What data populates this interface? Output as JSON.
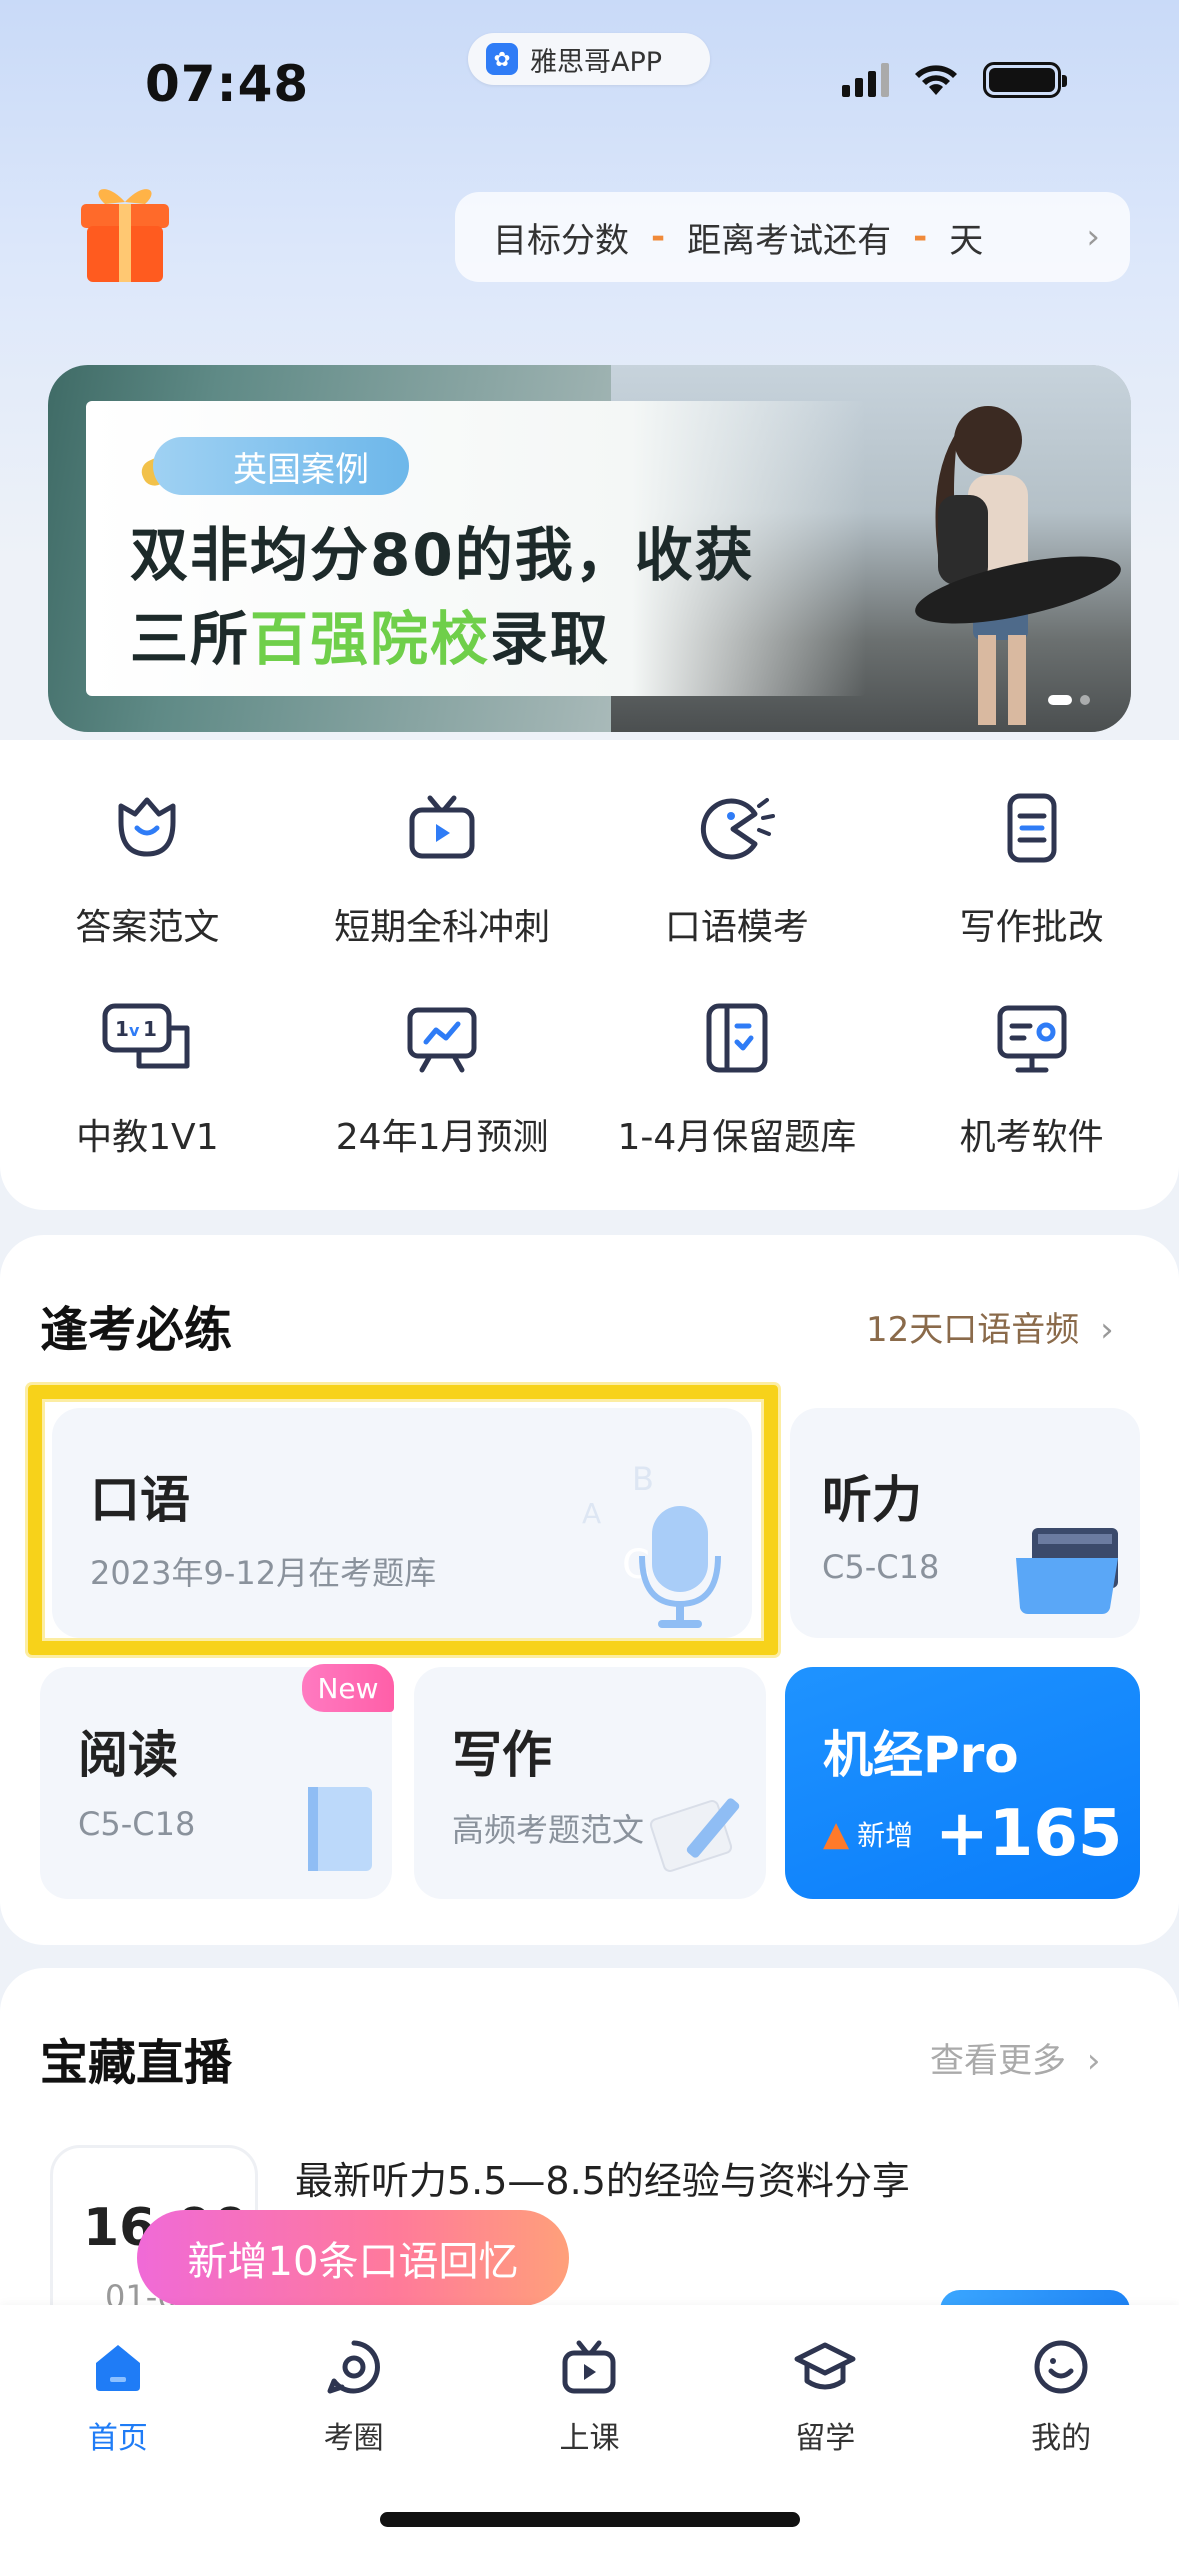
{
  "status_bar": {
    "time": "07:48",
    "app_pill": "雅思哥APP"
  },
  "target": {
    "target_label": "目标分数",
    "target_value": "-",
    "exam_label": "距离考试还有",
    "exam_value": "-",
    "unit": "天"
  },
  "banner": {
    "tag": "英国案例",
    "line1": "双非均分80的我，收获",
    "line2_a": "三所",
    "line2_green": "百强院校",
    "line2_b": "录取"
  },
  "grid": [
    {
      "label": "答案范文",
      "icon": "answer-icon"
    },
    {
      "label": "短期全科冲刺",
      "icon": "tv-play-icon"
    },
    {
      "label": "口语模考",
      "icon": "speaking-icon"
    },
    {
      "label": "写作批改",
      "icon": "writing-correction-icon"
    },
    {
      "label": "中教1V1",
      "icon": "tutor-1v1-icon"
    },
    {
      "label": "24年1月预测",
      "icon": "forecast-icon"
    },
    {
      "label": "1-4月保留题库",
      "icon": "question-bank-icon"
    },
    {
      "label": "机考软件",
      "icon": "computer-test-icon"
    }
  ],
  "practice": {
    "title": "逢考必练",
    "link": "12天口语音频",
    "speaking": {
      "title": "口语",
      "sub": "2023年9-12月在考题库"
    },
    "listening": {
      "title": "听力",
      "sub": "C5-C18"
    },
    "reading": {
      "title": "阅读",
      "sub": "C5-C18",
      "badge": "New"
    },
    "writing": {
      "title": "写作",
      "sub": "高频考题范文"
    },
    "pro": {
      "title": "机经Pro",
      "new_label": "新增",
      "count": "+165"
    }
  },
  "live": {
    "title": "宝藏直播",
    "more": "查看更多",
    "time": "16:00",
    "date": "01-02",
    "item_title": "最新听力5.5—8.5的经验与资料分享",
    "toast": "新增10条口语回忆"
  },
  "tabs": [
    {
      "label": "首页",
      "icon": "home-icon",
      "active": true
    },
    {
      "label": "考圈",
      "icon": "community-icon",
      "active": false
    },
    {
      "label": "上课",
      "icon": "class-icon",
      "active": false
    },
    {
      "label": "留学",
      "icon": "study-abroad-icon",
      "active": false
    },
    {
      "label": "我的",
      "icon": "profile-icon",
      "active": false
    }
  ],
  "colors": {
    "accent": "#1f7cf6",
    "highlight": "#f7d21a",
    "green_text": "#6fcf4a",
    "pro_blue": "#0a7dfa"
  }
}
